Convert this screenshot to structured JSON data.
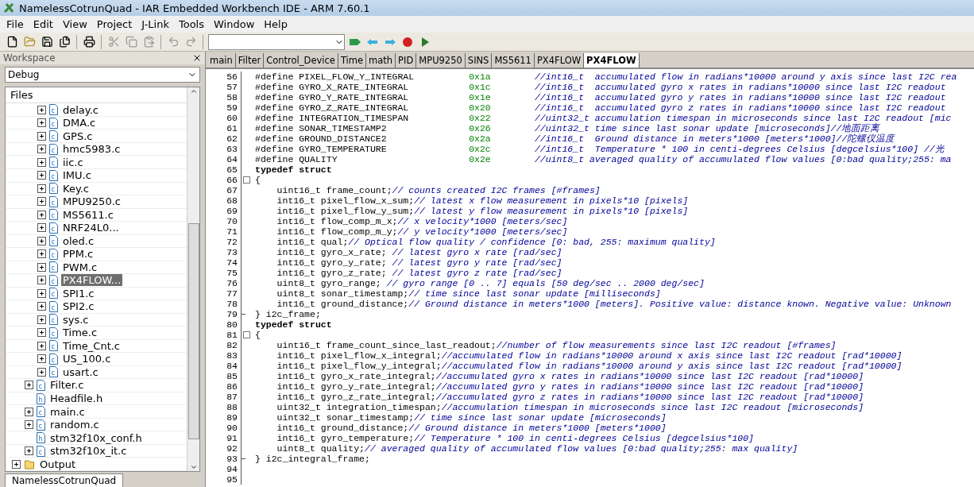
{
  "window": {
    "title": "NamelessCotrunQuad - IAR Embedded Workbench IDE - ARM 7.60.1"
  },
  "menu": [
    "File",
    "Edit",
    "View",
    "Project",
    "J-Link",
    "Tools",
    "Window",
    "Help"
  ],
  "workspace": {
    "title": "Workspace",
    "config": "Debug",
    "files_header": "Files",
    "tree": [
      {
        "children": [
          {
            "children": [
              {
                "label": "delay.c",
                "kind": "c",
                "expanded": false,
                "selected": false
              },
              {
                "label": "DMA.c",
                "kind": "c",
                "expanded": false,
                "selected": false
              },
              {
                "label": "GPS.c",
                "kind": "c",
                "expanded": false,
                "selected": false
              },
              {
                "label": "hmc5983.c",
                "kind": "c",
                "expanded": false,
                "selected": false
              },
              {
                "label": "iic.c",
                "kind": "c",
                "expanded": false,
                "selected": false
              },
              {
                "label": "IMU.c",
                "kind": "c",
                "expanded": false,
                "selected": false
              },
              {
                "label": "Key.c",
                "kind": "c",
                "expanded": false,
                "selected": false
              },
              {
                "label": "MPU9250.c",
                "kind": "c",
                "expanded": false,
                "selected": false
              },
              {
                "label": "MS5611.c",
                "kind": "c",
                "expanded": false,
                "selected": false
              },
              {
                "label": "NRF24L0...",
                "kind": "c",
                "expanded": false,
                "selected": false
              },
              {
                "label": "oled.c",
                "kind": "c",
                "expanded": false,
                "selected": false
              },
              {
                "label": "PPM.c",
                "kind": "c",
                "expanded": false,
                "selected": false
              },
              {
                "label": "PWM.c",
                "kind": "c",
                "expanded": false,
                "selected": false
              },
              {
                "label": "PX4FLOW...",
                "kind": "c",
                "expanded": false,
                "selected": true
              },
              {
                "label": "SPI1.c",
                "kind": "c",
                "expanded": false,
                "selected": false
              },
              {
                "label": "SPI2.c",
                "kind": "c",
                "expanded": false,
                "selected": false
              },
              {
                "label": "sys.c",
                "kind": "c",
                "expanded": false,
                "selected": false
              },
              {
                "label": "Time.c",
                "kind": "c",
                "expanded": false,
                "selected": false
              },
              {
                "label": "Time_Cnt.c",
                "kind": "c",
                "expanded": false,
                "selected": false
              },
              {
                "label": "US_100.c",
                "kind": "c",
                "expanded": false,
                "selected": false
              },
              {
                "label": "usart.c",
                "kind": "c",
                "expanded": false,
                "selected": false
              }
            ]
          },
          {
            "label": "Filter.c",
            "kind": "c",
            "expanded": false,
            "selected": false
          },
          {
            "label": "Headfile.h",
            "kind": "h",
            "selected": false
          },
          {
            "label": "main.c",
            "kind": "c",
            "expanded": false,
            "selected": false
          },
          {
            "label": "random.c",
            "kind": "c",
            "expanded": false,
            "selected": false
          },
          {
            "label": "stm32f10x_conf.h",
            "kind": "h",
            "selected": false
          },
          {
            "label": "stm32f10x_it.c",
            "kind": "c",
            "expanded": false,
            "selected": false
          }
        ]
      },
      {
        "label": "Output",
        "kind": "folder",
        "expanded": false,
        "selected": false
      }
    ],
    "bottom_tab": "NamelessCotrunQuad"
  },
  "tabs": [
    {
      "label": "main",
      "selected": false
    },
    {
      "label": "Filter",
      "selected": false
    },
    {
      "label": "Control_Device",
      "selected": false
    },
    {
      "label": "Time",
      "selected": false
    },
    {
      "label": "math",
      "selected": false
    },
    {
      "label": "PID",
      "selected": false
    },
    {
      "label": "MPU9250",
      "selected": false
    },
    {
      "label": "SINS",
      "selected": false
    },
    {
      "label": "MS5611",
      "selected": false
    },
    {
      "label": "PX4FLOW",
      "selected": false
    },
    {
      "label": "PX4FLOW",
      "selected": true
    }
  ],
  "code": [
    {
      "number": "56",
      "kind": "define",
      "keyword": "#define",
      "name": "PIXEL_FLOW_Y_INTEGRAL",
      "value": "0x1a",
      "comment": "//int16_t  accumulated flow in radians*10000 around y axis since last I2C rea"
    },
    {
      "number": "57",
      "kind": "define",
      "keyword": "#define",
      "name": "GYRO_X_RATE_INTEGRAL",
      "value": "0x1c",
      "comment": "//int16_t  accumulated gyro x rates in radians*10000 since last I2C readout"
    },
    {
      "number": "58",
      "kind": "define",
      "keyword": "#define",
      "name": "GYRO_Y_RATE_INTEGRAL",
      "value": "0x1e",
      "comment": "//int16_t  accumulated gyro y rates in radians*10000 since last I2C readout"
    },
    {
      "number": "59",
      "kind": "define",
      "keyword": "#define",
      "name": "GYRO_Z_RATE_INTEGRAL",
      "value": "0x20",
      "comment": "//int16_t  accumulated gyro z rates in radians*10000 since last I2C readout"
    },
    {
      "number": "60",
      "kind": "define",
      "keyword": "#define",
      "name": "INTEGRATION_TIMESPAN",
      "value": "0x22",
      "comment": "//uint32_t accumulation timespan in microseconds since last I2C readout [mic"
    },
    {
      "number": "61",
      "kind": "define",
      "keyword": "#define",
      "name": "SONAR_TIMESTAMP2",
      "value": "0x26",
      "comment": "//uint32_t time since last sonar update [microseconds]//地面距离"
    },
    {
      "number": "62",
      "kind": "define",
      "keyword": "#define",
      "name": "GROUND_DISTANCE2",
      "value": "0x2a",
      "comment": "//int16_t  Ground distance in meters*1000 [meters*1000]//陀螺仪温度"
    },
    {
      "number": "63",
      "kind": "define",
      "keyword": "#define",
      "name": "GYRO_TEMPERATURE",
      "value": "0x2c",
      "comment": "//int16_t  Temperature * 100 in centi-degrees Celsius [degcelsius*100] //光"
    },
    {
      "number": "64",
      "kind": "define",
      "keyword": "#define",
      "name": "QUALITY",
      "value": "0x2e",
      "comment": "//uint8_t averaged quality of accumulated flow values [0:bad quality;255: ma"
    },
    {
      "number": "65",
      "kind": "keyword",
      "code": "typedef struct"
    },
    {
      "number": "66",
      "kind": "block_start",
      "code": "{"
    },
    {
      "number": "67",
      "kind": "code",
      "code": "    uint16_t frame_count;",
      "comment": "// counts created I2C frames [#frames]"
    },
    {
      "number": "68",
      "kind": "code",
      "code": "    int16_t pixel_flow_x_sum;",
      "comment": "// latest x flow measurement in pixels*10 [pixels]"
    },
    {
      "number": "69",
      "kind": "code",
      "code": "    int16_t pixel_flow_y_sum;",
      "comment": "// latest y flow measurement in pixels*10 [pixels]"
    },
    {
      "number": "70",
      "kind": "code",
      "code": "    int16_t flow_comp_m_x;",
      "comment": "// x velocity*1000 [meters/sec]"
    },
    {
      "number": "71",
      "kind": "code",
      "code": "    int16_t flow_comp_m_y;",
      "comment": "// y velocity*1000 [meters/sec]"
    },
    {
      "number": "72",
      "kind": "code",
      "code": "    int16_t qual;",
      "comment": "// Optical flow quality / confidence [0: bad, 255: maximum quality]"
    },
    {
      "number": "73",
      "kind": "code",
      "code": "    int16_t gyro_x_rate; ",
      "comment": "// latest gyro x rate [rad/sec]"
    },
    {
      "number": "74",
      "kind": "code",
      "code": "    int16_t gyro_y_rate; ",
      "comment": "// latest gyro y rate [rad/sec]"
    },
    {
      "number": "75",
      "kind": "code",
      "code": "    int16_t gyro_z_rate; ",
      "comment": "// latest gyro z rate [rad/sec]"
    },
    {
      "number": "76",
      "kind": "code",
      "code": "    uint8_t gyro_range; ",
      "comment": "// gyro range [0 .. 7] equals [50 deg/sec .. 2000 deg/sec]"
    },
    {
      "number": "77",
      "kind": "code",
      "code": "    uint8_t sonar_timestamp;",
      "comment": "// time since last sonar update [milliseconds]"
    },
    {
      "number": "78",
      "kind": "code",
      "code": "    int16_t ground_distance;",
      "comment": "// Ground distance in meters*1000 [meters]. Positive value: distance known. Negative value: Unknown"
    },
    {
      "number": "79",
      "kind": "block_end",
      "code": "} i2c_frame;"
    },
    {
      "number": "80",
      "kind": "keyword",
      "code": "typedef struct"
    },
    {
      "number": "81",
      "kind": "block_start",
      "code": "{"
    },
    {
      "number": "82",
      "kind": "code",
      "code": "    uint16_t frame_count_since_last_readout;",
      "comment": "//number of flow measurements since last I2C readout [#frames]"
    },
    {
      "number": "83",
      "kind": "code",
      "code": "    int16_t pixel_flow_x_integral;",
      "comment": "//accumulated flow in radians*10000 around x axis since last I2C readout [rad*10000]"
    },
    {
      "number": "84",
      "kind": "code",
      "code": "    int16_t pixel_flow_y_integral;",
      "comment": "//accumulated flow in radians*10000 around y axis since last I2C readout [rad*10000]"
    },
    {
      "number": "85",
      "kind": "code",
      "code": "    int16_t gyro_x_rate_integral;",
      "comment": "//accumulated gyro x rates in radians*10000 since last I2C readout [rad*10000]"
    },
    {
      "number": "86",
      "kind": "code",
      "code": "    int16_t gyro_y_rate_integral;",
      "comment": "//accumulated gyro y rates in radians*10000 since last I2C readout [rad*10000]"
    },
    {
      "number": "87",
      "kind": "code",
      "code": "    int16_t gyro_z_rate_integral;",
      "comment": "//accumulated gyro z rates in radians*10000 since last I2C readout [rad*10000]"
    },
    {
      "number": "88",
      "kind": "code",
      "code": "    uint32_t integration_timespan;",
      "comment": "//accumulation timespan in microseconds since last I2C readout [microseconds]"
    },
    {
      "number": "89",
      "kind": "code",
      "code": "    uint32_t sonar_timestamp;",
      "comment": "// time since last sonar update [microseconds]"
    },
    {
      "number": "90",
      "kind": "code",
      "code": "    int16_t ground_distance;",
      "comment": "// Ground distance in meters*1000 [meters*1000]"
    },
    {
      "number": "91",
      "kind": "code",
      "code": "    int16_t gyro_temperature;",
      "comment": "// Temperature * 100 in centi-degrees Celsius [degcelsius*100]"
    },
    {
      "number": "92",
      "kind": "code",
      "code": "    uint8_t quality;",
      "comment": "// averaged quality of accumulated flow values [0:bad quality;255: max quality]"
    },
    {
      "number": "93",
      "kind": "block_end",
      "code": "} i2c_integral_frame;"
    },
    {
      "number": "94",
      "kind": "code"
    },
    {
      "number": "95",
      "kind": "code"
    }
  ]
}
